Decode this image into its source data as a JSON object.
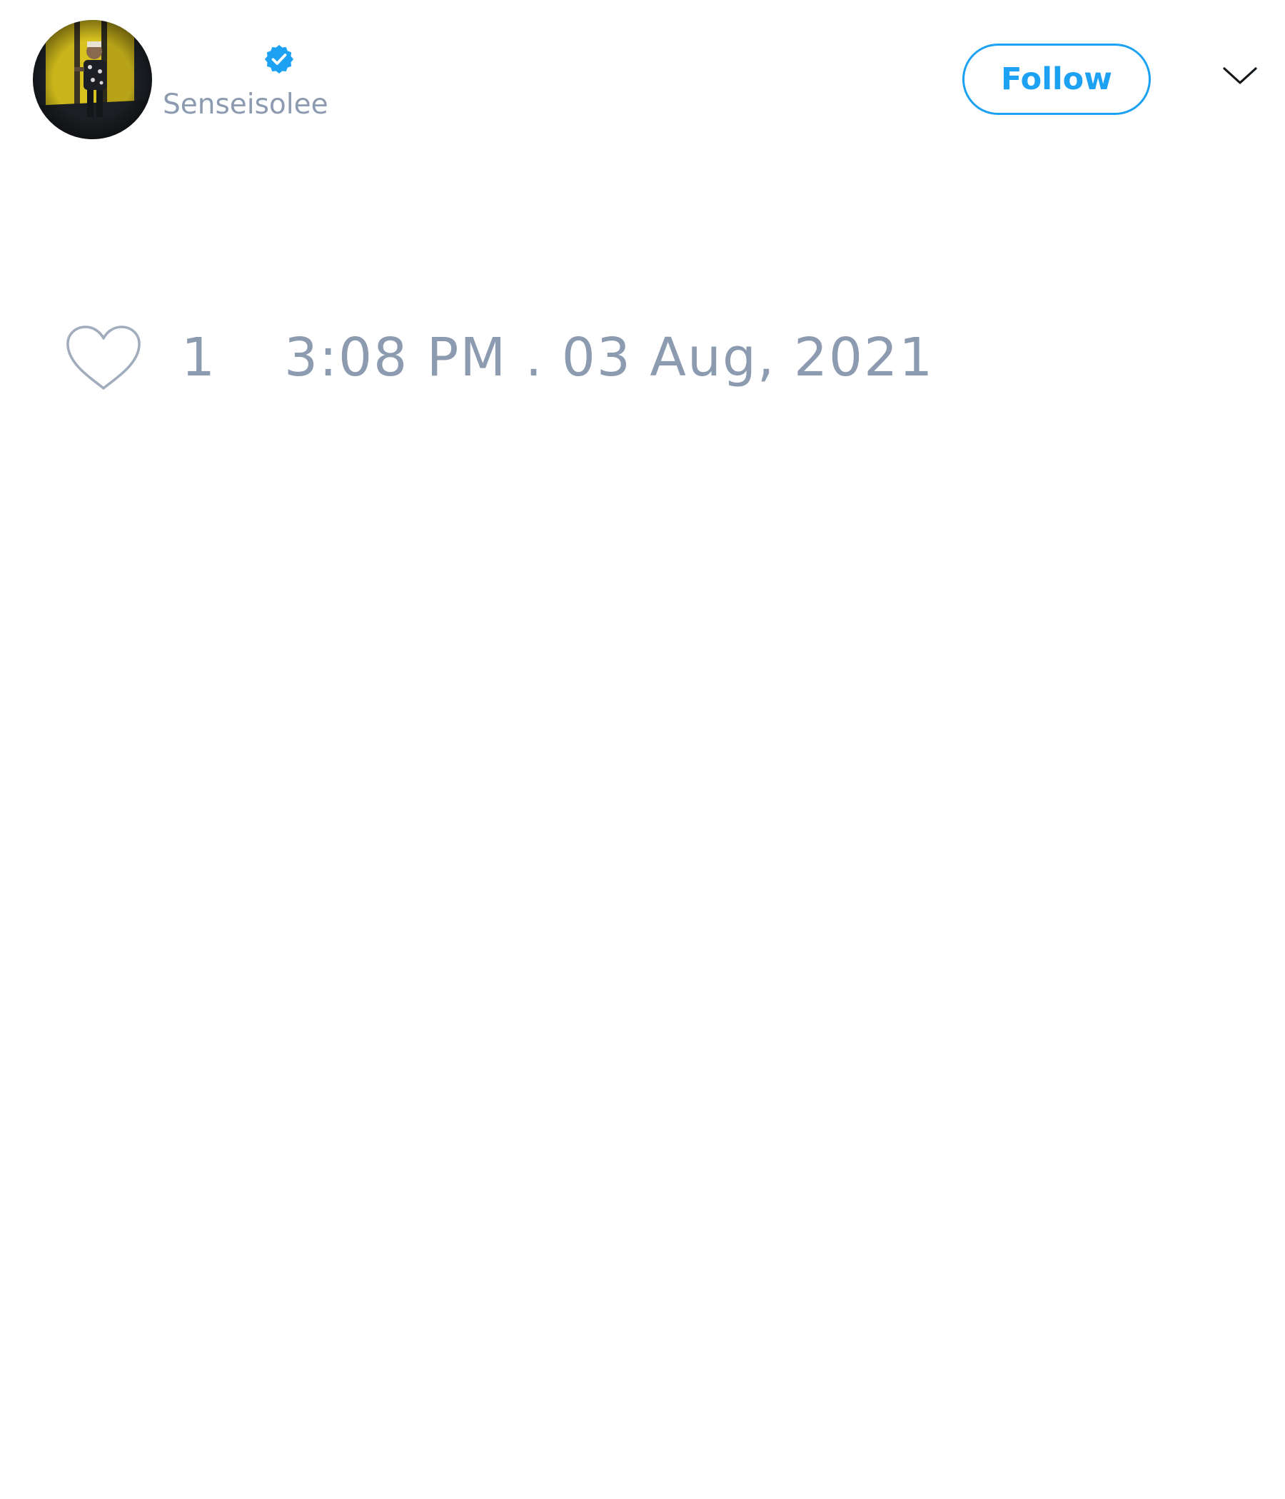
{
  "author": {
    "display_name": "",
    "handle": "Senseisolee",
    "verified": true,
    "avatar_icon": "profile-photo"
  },
  "header": {
    "follow_label": "Follow",
    "menu_icon": "chevron-down-icon"
  },
  "stats": {
    "like_icon": "heart-outline-icon",
    "like_count": "1",
    "timestamp": "3:08 PM . 03 Aug, 2021"
  },
  "colors": {
    "accent": "#1da1f2",
    "muted_text": "#8c9bb0",
    "background": "#ffffff"
  }
}
